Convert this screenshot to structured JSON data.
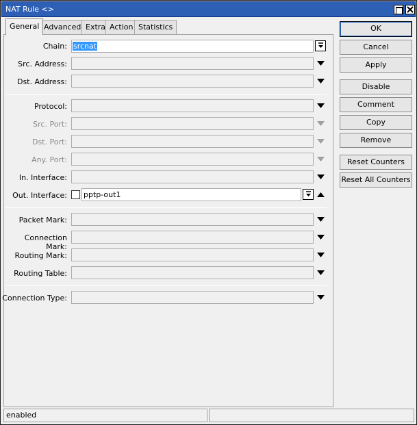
{
  "window": {
    "title": "NAT Rule <>"
  },
  "tabs": [
    {
      "label": "General"
    },
    {
      "label": "Advanced"
    },
    {
      "label": "Extra"
    },
    {
      "label": "Action"
    },
    {
      "label": "Statistics"
    }
  ],
  "fields": {
    "chain": {
      "label": "Chain:",
      "value": "srcnat"
    },
    "src_address": {
      "label": "Src. Address:"
    },
    "dst_address": {
      "label": "Dst. Address:"
    },
    "protocol": {
      "label": "Protocol:"
    },
    "src_port": {
      "label": "Src. Port:"
    },
    "dst_port": {
      "label": "Dst. Port:"
    },
    "any_port": {
      "label": "Any. Port:"
    },
    "in_interface": {
      "label": "In. Interface:"
    },
    "out_interface": {
      "label": "Out. Interface:",
      "value": "pptp-out1",
      "negate_checked": false
    },
    "packet_mark": {
      "label": "Packet Mark:"
    },
    "connection_mark": {
      "label": "Connection Mark:"
    },
    "routing_mark": {
      "label": "Routing Mark:"
    },
    "routing_table": {
      "label": "Routing Table:"
    },
    "connection_type": {
      "label": "Connection Type:"
    }
  },
  "buttons": {
    "ok": "OK",
    "cancel": "Cancel",
    "apply": "Apply",
    "disable": "Disable",
    "comment": "Comment",
    "copy": "Copy",
    "remove": "Remove",
    "reset_counters": "Reset Counters",
    "reset_all_counters": "Reset All Counters"
  },
  "status": {
    "state": "enabled",
    "extra": ""
  },
  "colors": {
    "titlebar": "#2d5fb4",
    "selection": "#3399ff"
  },
  "icons": {
    "maximize": "maximize-icon",
    "close": "close-icon",
    "dropdown": "dropdown-arrow-icon",
    "collapse": "collapse-arrow-icon"
  }
}
